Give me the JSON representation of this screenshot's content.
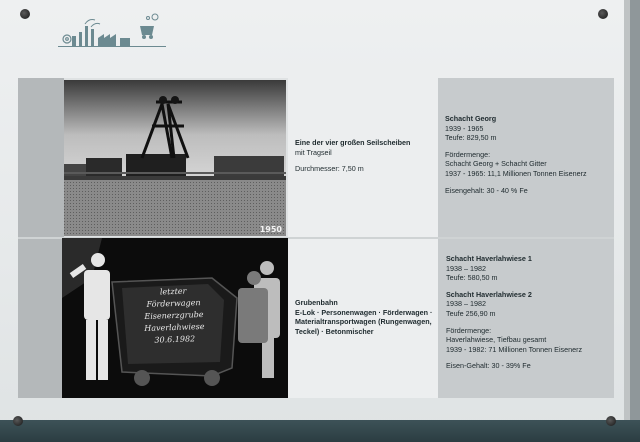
{
  "row1": {
    "caption_title": "Eine der vier großen Seilscheiben",
    "caption_sub": "mit Tragseil",
    "caption_diameter": "Durchmesser: 7,50 m",
    "photo_year": "1950",
    "shaft": {
      "name": "Schacht Georg",
      "years": "1939 - 1965",
      "depth": "Teufe: 829,50 m",
      "output_label": "Fördermenge:",
      "output_line1": "Schacht Georg + Schacht Gitter",
      "output_line2": "1937 - 1965: 11,1 Millionen Tonnen Eisenerz",
      "iron_content": "Eisengehalt: 30 - 40 % Fe"
    }
  },
  "row2": {
    "caption_title": "Grubenbahn",
    "caption_line1": "E-Lok · Personenwagen · Förderwagen ·",
    "caption_line2": "Materialtransportwagen (Rungenwagen,",
    "caption_line3": "Teckel) · Betonmischer",
    "cart_text": [
      "letzter",
      "Förderwagen",
      "Eisenerzgrube",
      "Haverlahwiese",
      "30.6.1982"
    ],
    "shaft1": {
      "name": "Schacht Haverlahwiese 1",
      "years": "1938 – 1982",
      "depth": "Teufe: 580,50 m"
    },
    "shaft2": {
      "name": "Schacht Haverlahwiese 2",
      "years": "1938 – 1982",
      "depth": "Teufe 256,90 m"
    },
    "output_label": "Fördermenge:",
    "output_line1": "Haverlahwiese, Tiefbau gesamt",
    "output_line2": "1939 - 1982: 71 Millionen Tonnen Eisenerz",
    "iron_content": "Eisen-Gehalt: 30 - 39% Fe"
  },
  "colors": {
    "rail": "#2b3d42",
    "panel": "#dfe2e3",
    "right_col": "#c7cbcd",
    "text": "#1e2a2e"
  }
}
